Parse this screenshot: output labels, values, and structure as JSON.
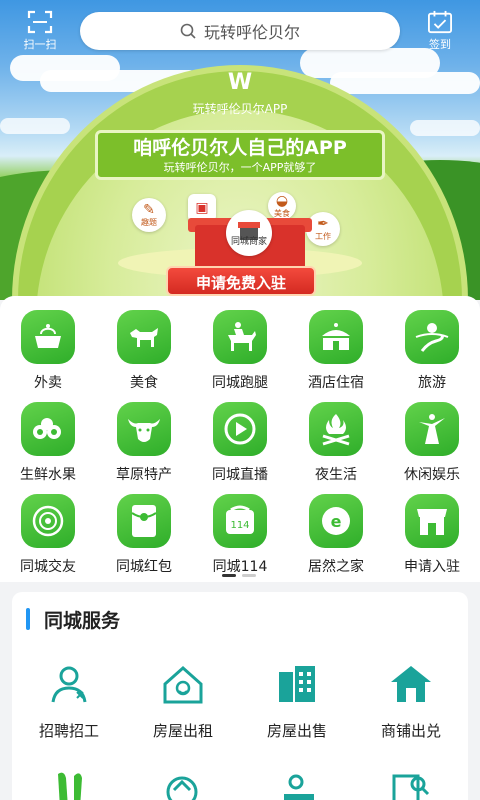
{
  "header": {
    "scan_label": "扫一扫",
    "checkin_label": "签到",
    "search_placeholder": "玩转呼伦贝尔"
  },
  "banner": {
    "logo_text": "W",
    "app_name": "玩转呼伦贝尔APP",
    "slogan_main": "咱呼伦贝尔人自己的APP",
    "slogan_sub": "玩转呼伦贝尔，一个APP就够了",
    "bubbles": [
      "趣题",
      "美食",
      "工作"
    ],
    "merchant_label": "同城商家",
    "cta_label": "申请免费入驻"
  },
  "grid": {
    "items": [
      {
        "label": "外卖",
        "icon": "takeout-icon"
      },
      {
        "label": "美食",
        "icon": "bull-icon"
      },
      {
        "label": "同城跑腿",
        "icon": "horse-rider-icon"
      },
      {
        "label": "酒店住宿",
        "icon": "yurt-icon"
      },
      {
        "label": "旅游",
        "icon": "road-icon"
      },
      {
        "label": "生鲜水果",
        "icon": "fruit-icon"
      },
      {
        "label": "草原特产",
        "icon": "cow-head-icon"
      },
      {
        "label": "同城直播",
        "icon": "play-icon"
      },
      {
        "label": "夜生活",
        "icon": "bonfire-icon"
      },
      {
        "label": "休闲娱乐",
        "icon": "dancer-icon"
      },
      {
        "label": "同城交友",
        "icon": "record-icon"
      },
      {
        "label": "同城红包",
        "icon": "red-packet-icon"
      },
      {
        "label": "同城114",
        "icon": "phone-114-icon"
      },
      {
        "label": "居然之家",
        "icon": "home-brand-icon"
      },
      {
        "label": "申请入驻",
        "icon": "store-icon"
      }
    ],
    "page_indicator": {
      "current": 1,
      "total": 2
    }
  },
  "services": {
    "title": "同城服务",
    "items": [
      {
        "label": "招聘招工",
        "icon": "recruit-icon"
      },
      {
        "label": "房屋出租",
        "icon": "house-rent-icon"
      },
      {
        "label": "房屋出售",
        "icon": "building-sale-icon"
      },
      {
        "label": "商铺出兑",
        "icon": "shop-transfer-icon"
      }
    ]
  },
  "colors": {
    "brand_green": "#3dbb34",
    "accent_blue": "#2196f3",
    "service_teal": "#1aa39a",
    "cta_red": "#d42a21"
  }
}
